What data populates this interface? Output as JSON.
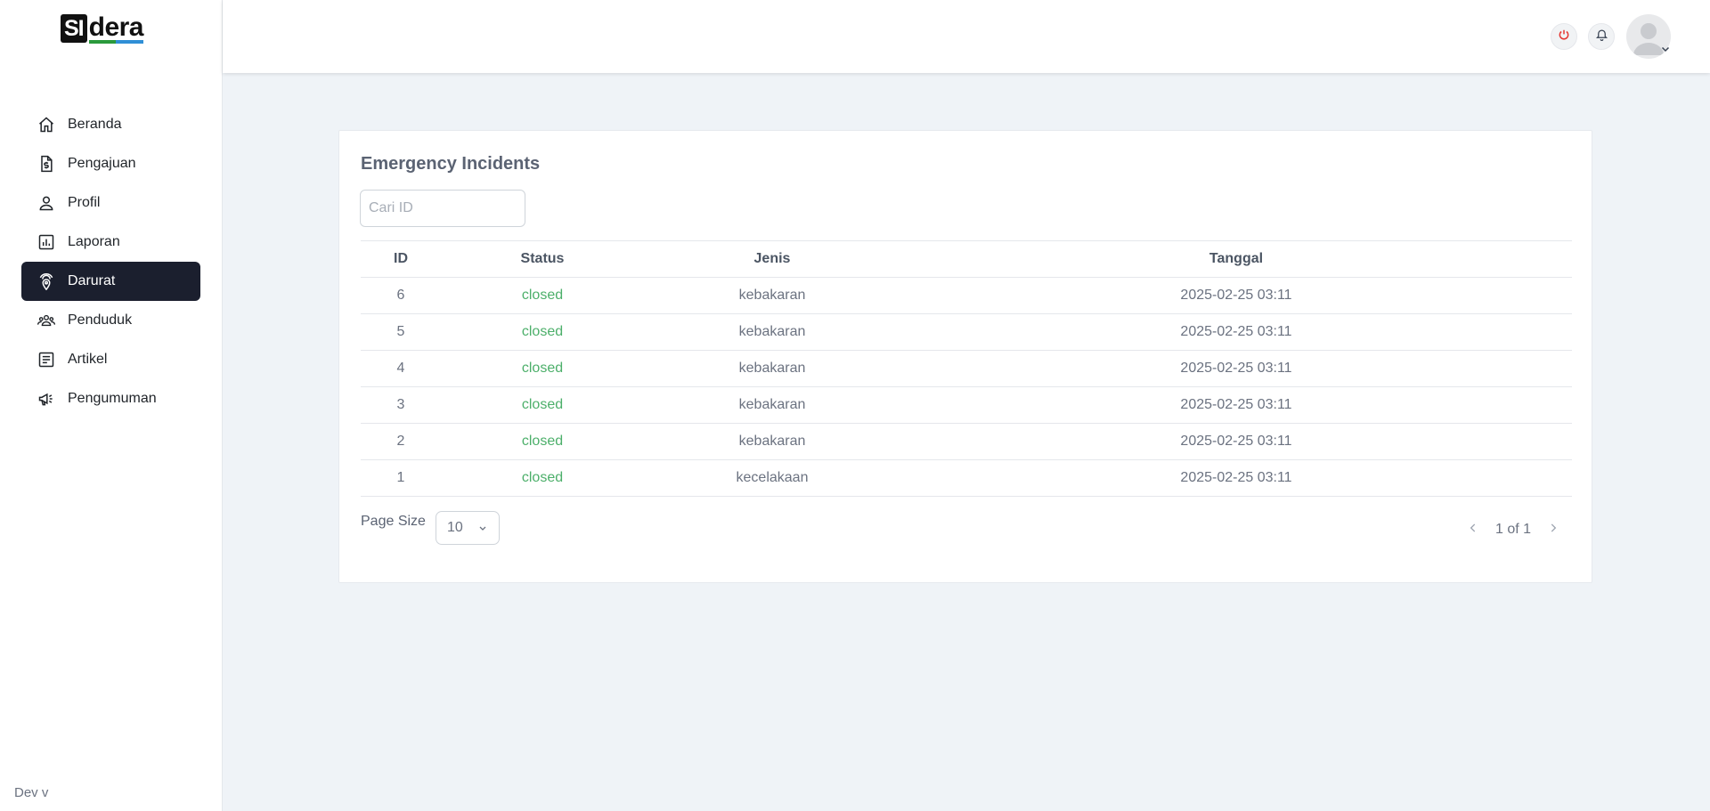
{
  "app": {
    "logo_box": "SI",
    "logo_text": "dera"
  },
  "sidebar": {
    "items": [
      {
        "label": "Beranda",
        "icon": "home-icon",
        "active": false
      },
      {
        "label": "Pengajuan",
        "icon": "document-dollar-icon",
        "active": false
      },
      {
        "label": "Profil",
        "icon": "user-icon",
        "active": false
      },
      {
        "label": "Laporan",
        "icon": "chart-icon",
        "active": false
      },
      {
        "label": "Darurat",
        "icon": "emergency-beacon-icon",
        "active": true
      },
      {
        "label": "Penduduk",
        "icon": "people-icon",
        "active": false
      },
      {
        "label": "Artikel",
        "icon": "article-icon",
        "active": false
      },
      {
        "label": "Pengumuman",
        "icon": "megaphone-icon",
        "active": false
      }
    ],
    "version": "Dev v"
  },
  "header": {
    "icons": [
      "power-icon",
      "bell-icon",
      "avatar",
      "chevron-down-icon"
    ]
  },
  "main": {
    "title": "Emergency Incidents",
    "search": {
      "placeholder": "Cari ID",
      "value": ""
    },
    "table": {
      "columns": [
        "ID",
        "Status",
        "Jenis",
        "Tanggal"
      ],
      "rows": [
        {
          "id": "6",
          "status": "closed",
          "jenis": "kebakaran",
          "tanggal": "2025-02-25 03:11"
        },
        {
          "id": "5",
          "status": "closed",
          "jenis": "kebakaran",
          "tanggal": "2025-02-25 03:11"
        },
        {
          "id": "4",
          "status": "closed",
          "jenis": "kebakaran",
          "tanggal": "2025-02-25 03:11"
        },
        {
          "id": "3",
          "status": "closed",
          "jenis": "kebakaran",
          "tanggal": "2025-02-25 03:11"
        },
        {
          "id": "2",
          "status": "closed",
          "jenis": "kebakaran",
          "tanggal": "2025-02-25 03:11"
        },
        {
          "id": "1",
          "status": "closed",
          "jenis": "kecelakaan",
          "tanggal": "2025-02-25 03:11"
        }
      ]
    },
    "pagination": {
      "page_size_label": "Page Size",
      "page_size_value": "10",
      "page_label": "1 of 1"
    }
  },
  "colors": {
    "active_nav": "#1b1f2e",
    "status_closed": "#4caf6a",
    "power_icon": "#e53935"
  }
}
